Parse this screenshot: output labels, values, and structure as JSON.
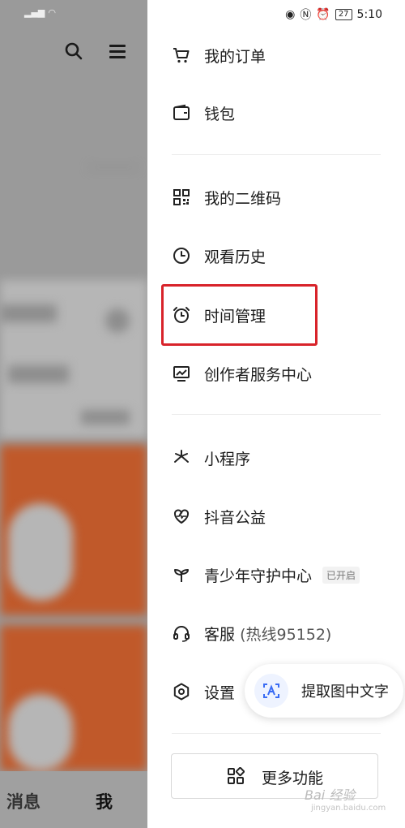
{
  "status_bar": {
    "time": "5:10",
    "battery": "27"
  },
  "left_panel": {
    "tabs": {
      "messages": "消息",
      "me": "我"
    }
  },
  "drawer": {
    "items": [
      {
        "label": "我的订单",
        "icon": "cart-icon"
      },
      {
        "label": "钱包",
        "icon": "wallet-icon"
      },
      {
        "label": "我的二维码",
        "icon": "qr-code-icon"
      },
      {
        "label": "观看历史",
        "icon": "history-clock-icon"
      },
      {
        "label": "时间管理",
        "icon": "alarm-clock-icon"
      },
      {
        "label": "创作者服务中心",
        "icon": "chart-monitor-icon"
      },
      {
        "label": "小程序",
        "icon": "mini-program-icon"
      },
      {
        "label": "抖音公益",
        "icon": "charity-heart-icon"
      },
      {
        "label": "青少年守护中心",
        "icon": "sprout-icon",
        "badge": "已开启"
      },
      {
        "label": "客服",
        "label_sub": "(热线95152)",
        "icon": "headset-icon"
      },
      {
        "label": "设置",
        "icon": "settings-hexagon-icon"
      }
    ],
    "more_button": "更多功能"
  },
  "ocr_button": {
    "label": "提取图中文字"
  },
  "watermark": {
    "text": "Bai 经验",
    "url": "jingyan.baidu.com"
  },
  "colors": {
    "highlight": "#d8232a",
    "ocr_accent": "#3a6cf4"
  }
}
